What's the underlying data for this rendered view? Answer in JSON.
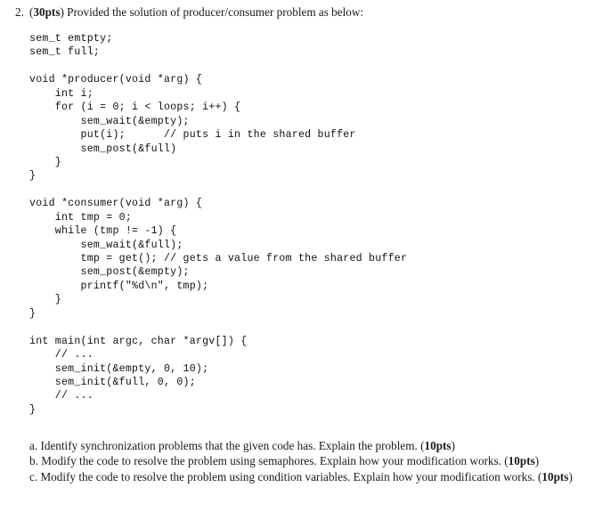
{
  "document": {
    "problem": {
      "number": "2.",
      "points_label": "30pts",
      "prefix": "(",
      "suffix": ")",
      "statement": " Provided the solution of producer/consumer problem as below:"
    },
    "code_listing": {
      "language": "c",
      "lines": [
        "sem_t emtpty;",
        "sem_t full;",
        "",
        "void *producer(void *arg) {",
        "    int i;",
        "    for (i = 0; i < loops; i++) {",
        "        sem_wait(&empty);",
        "        put(i);      // puts i in the shared buffer",
        "        sem_post(&full)",
        "    }",
        "}",
        "",
        "void *consumer(void *arg) {",
        "    int tmp = 0;",
        "    while (tmp != -1) {",
        "        sem_wait(&full);",
        "        tmp = get(); // gets a value from the shared buffer",
        "        sem_post(&empty);",
        "        printf(\"%d\\n\", tmp);",
        "    }",
        "}",
        "",
        "int main(int argc, char *argv[]) {",
        "    // ...",
        "    sem_init(&empty, 0, 10);",
        "    sem_init(&full, 0, 0);",
        "    // ...",
        "}"
      ]
    },
    "subquestions": [
      {
        "label": "a.",
        "text": " Identify synchronization problems that the given code has. Explain the problem. ",
        "points_label": "10pts"
      },
      {
        "label": "b.",
        "text": " Modify the code to resolve the problem using semaphores. Explain how your modification works. ",
        "points_label": "10pts"
      },
      {
        "label": "c.",
        "text": " Modify the code to resolve the problem using condition variables. Explain how your modification works. ",
        "points_label": "10pts"
      }
    ]
  },
  "colors": {
    "page_background": "#ffffff",
    "body_text": "#1a1a1a",
    "code_text": "#111111"
  }
}
